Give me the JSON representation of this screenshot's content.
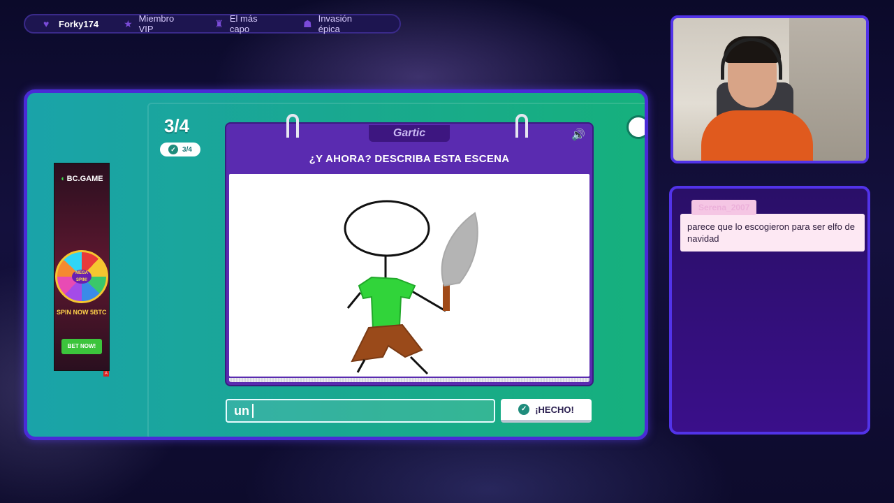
{
  "topbar": {
    "items": [
      {
        "label": "Forky174",
        "icon": "heart-icon"
      },
      {
        "label": "Miembro VIP",
        "icon": "star-icon"
      },
      {
        "label": "El más capo",
        "icon": "trophy-icon"
      },
      {
        "label": "Invasión épica",
        "icon": "group-icon"
      }
    ]
  },
  "game": {
    "round": "3/4",
    "round_badge": "3/4",
    "logo": "Gartic",
    "prompt": "¿Y AHORA? DESCRIBA ESTA ESCENA",
    "answer_value": "un",
    "done_label": "¡HECHO!"
  },
  "ad": {
    "brand": "BC.GAME",
    "wheel_text": "MEGA SPIN!",
    "promo": "5BTC",
    "promo_caption": "SPIN NOW",
    "cta": "BET NOW!"
  },
  "chat": {
    "messages": [
      {
        "user": "Serena_2007",
        "text": "parece que lo escogieron para ser elfo de navidad"
      }
    ]
  },
  "colors": {
    "accent": "#5233e8",
    "card": "#5a2bb0",
    "game_bg": "#19a98e"
  }
}
